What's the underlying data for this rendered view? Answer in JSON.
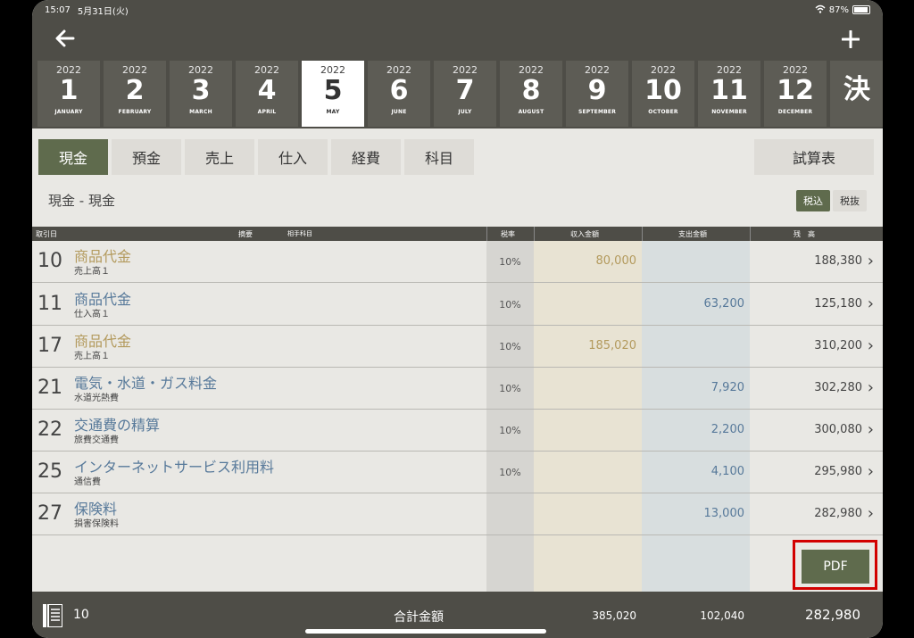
{
  "status": {
    "time": "15:07",
    "date": "5月31日(火)",
    "battery": "87%"
  },
  "months": [
    {
      "year": "2022",
      "num": "1",
      "name": "JANUARY"
    },
    {
      "year": "2022",
      "num": "2",
      "name": "FEBRUARY"
    },
    {
      "year": "2022",
      "num": "3",
      "name": "MARCH"
    },
    {
      "year": "2022",
      "num": "4",
      "name": "APRIL"
    },
    {
      "year": "2022",
      "num": "5",
      "name": "MAY"
    },
    {
      "year": "2022",
      "num": "6",
      "name": "JUNE"
    },
    {
      "year": "2022",
      "num": "7",
      "name": "JULY"
    },
    {
      "year": "2022",
      "num": "8",
      "name": "AUGUST"
    },
    {
      "year": "2022",
      "num": "9",
      "name": "SEPTEMBER"
    },
    {
      "year": "2022",
      "num": "10",
      "name": "OCTOBER"
    },
    {
      "year": "2022",
      "num": "11",
      "name": "NOVEMBER"
    },
    {
      "year": "2022",
      "num": "12",
      "name": "DECEMBER"
    }
  ],
  "kessan": "決",
  "tabs": [
    "現金",
    "預金",
    "売上",
    "仕入",
    "経費",
    "科目"
  ],
  "trial_balance": "試算表",
  "account_title": "現金 - 現金",
  "tax": {
    "incl": "税込",
    "excl": "税抜"
  },
  "columns": {
    "date": "取引日",
    "memo": "摘要",
    "partner": "相手科目",
    "rate": "税率",
    "income": "収入金額",
    "expense": "支出金額",
    "balance": "残　高"
  },
  "rows": [
    {
      "day": "10",
      "memo": "商品代金",
      "partner": "売上高１",
      "rate": "10%",
      "income": "80,000",
      "expense": "",
      "balance": "188,380",
      "type": "inc"
    },
    {
      "day": "11",
      "memo": "商品代金",
      "partner": "仕入高１",
      "rate": "10%",
      "income": "",
      "expense": "63,200",
      "balance": "125,180",
      "type": "exp"
    },
    {
      "day": "17",
      "memo": "商品代金",
      "partner": "売上高１",
      "rate": "10%",
      "income": "185,020",
      "expense": "",
      "balance": "310,200",
      "type": "inc"
    },
    {
      "day": "21",
      "memo": "電気・水道・ガス料金",
      "partner": "水道光熱費",
      "rate": "10%",
      "income": "",
      "expense": "7,920",
      "balance": "302,280",
      "type": "exp"
    },
    {
      "day": "22",
      "memo": "交通費の精算",
      "partner": "旅費交通費",
      "rate": "10%",
      "income": "",
      "expense": "2,200",
      "balance": "300,080",
      "type": "exp"
    },
    {
      "day": "25",
      "memo": "インターネットサービス利用料",
      "partner": "通信費",
      "rate": "10%",
      "income": "",
      "expense": "4,100",
      "balance": "295,980",
      "type": "exp"
    },
    {
      "day": "27",
      "memo": "保険料",
      "partner": "損害保険料",
      "rate": "",
      "income": "",
      "expense": "13,000",
      "balance": "282,980",
      "type": "exp"
    }
  ],
  "pdf_label": "PDF",
  "footer": {
    "count": "10",
    "total_label": "合計金額",
    "total_income": "385,020",
    "total_expense": "102,040",
    "total_balance": "282,980"
  }
}
